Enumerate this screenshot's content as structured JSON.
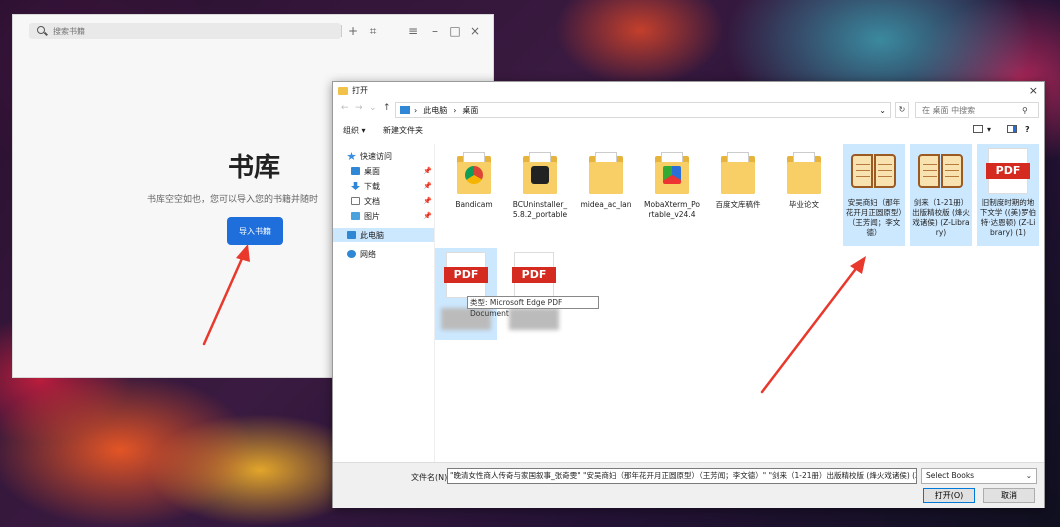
{
  "app": {
    "search_placeholder": "搜索书籍",
    "icons": [
      "plus-icon",
      "scan-icon",
      "menu-icon",
      "minimize-icon",
      "maximize-icon",
      "close-icon"
    ],
    "title": "书库",
    "description": "书库空空如也，您可以导入您的书籍并随时",
    "import_button": "导入书籍",
    "accent_color": "#1e6fdc"
  },
  "dialog": {
    "title": "打开",
    "close": "×",
    "breadcrumb": [
      "此电脑",
      "桌面"
    ],
    "search_placeholder": "在 桌面 中搜索",
    "toolbar": {
      "organize": "组织 ▾",
      "new_folder": "新建文件夹"
    },
    "nav": [
      {
        "label": "快速访问",
        "icon": "star-icon"
      },
      {
        "label": "桌面",
        "icon": "desktop-icon"
      },
      {
        "label": "下载",
        "icon": "download-icon"
      },
      {
        "label": "文档",
        "icon": "document-icon"
      },
      {
        "label": "图片",
        "icon": "picture-icon"
      },
      {
        "label": "此电脑",
        "icon": "pc-icon"
      },
      {
        "label": "网络",
        "icon": "network-icon"
      }
    ],
    "files": [
      {
        "name": "Bandicam",
        "kind": "folder"
      },
      {
        "name": "BCUninstaller_5.8.2_portable",
        "kind": "folder"
      },
      {
        "name": "midea_ac_lan",
        "kind": "folder"
      },
      {
        "name": "MobaXterm_Portable_v24.4",
        "kind": "folder"
      },
      {
        "name": "百度文库稿件",
        "kind": "folder"
      },
      {
        "name": "毕业论文",
        "kind": "folder"
      },
      {
        "name": "安吴商妇（那年花开月正圆原型）（王芳闻；李文德）",
        "kind": "book"
      },
      {
        "name": "剑来（1-21册）出版精校版 (烽火戏诸侯) (Z-Library)",
        "kind": "book"
      },
      {
        "name": "旧制度时期的地下文学 ((美)罗伯特·达恩顿) (Z-Library) (1)",
        "kind": "pdf"
      },
      {
        "name": "",
        "kind": "pdf"
      },
      {
        "name": "",
        "kind": "pdf"
      }
    ],
    "tooltip": "类型: Microsoft Edge PDF Document",
    "filename_label": "文件名(N):",
    "filename_value": "\"晚清女性商人传奇与家国叙事_张奇雯\" \"安吴商妇（那年花开月正圆原型）（王芳闻；李文德）\" \"剑来（1-21册）出版精校版 (烽火戏诸侯) (Z-L",
    "file_type": "Select Books",
    "open_button": "打开(O)",
    "cancel_button": "取消"
  },
  "colors": {
    "selection": "#cce8ff",
    "pdf_red": "#d42a20",
    "folder": "#f7cf66",
    "annotation_arrow": "#e8392c"
  }
}
